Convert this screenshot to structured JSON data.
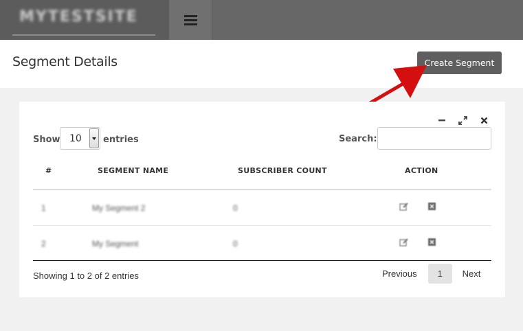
{
  "navbar": {
    "brand": "MYTESTSITE"
  },
  "header": {
    "title": "Segment Details",
    "create_button": "Create Segment"
  },
  "table_controls": {
    "show_label": "Show",
    "entries_value": "10",
    "entries_label": "entries",
    "search_label": "Search:"
  },
  "table": {
    "columns": [
      "#",
      "SEGMENT NAME",
      "SUBSCRIBER COUNT",
      "ACTION"
    ],
    "rows": [
      {
        "num": "1",
        "name": "My Segment 2",
        "count": "0"
      },
      {
        "num": "2",
        "name": "My Segment",
        "count": "0"
      }
    ]
  },
  "footer": {
    "info": "Showing 1 to 2 of 2 entries",
    "previous": "Previous",
    "current_page": "1",
    "next": "Next"
  },
  "colors": {
    "topbar": "#676767",
    "button": "#5f5f5f",
    "arrow": "#d40f0f"
  }
}
